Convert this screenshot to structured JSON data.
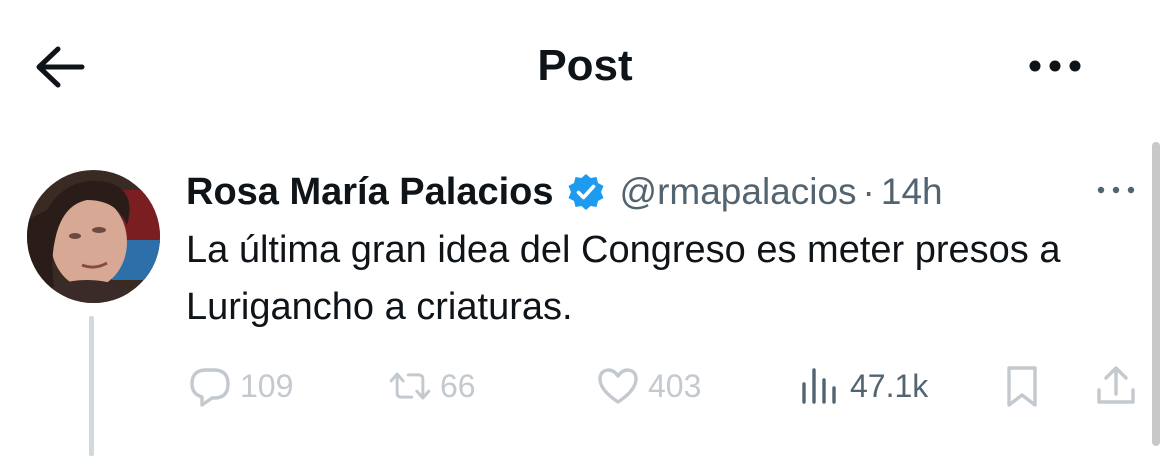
{
  "header": {
    "title": "Post",
    "back_icon": "arrow-left-icon",
    "more_icon": "ellipsis-icon"
  },
  "post": {
    "author_name": "Rosa María Palacios",
    "verified_color": "#1d9bf0",
    "handle": "@rmapalacios",
    "separator": "·",
    "time": "14h",
    "text": "La última gran idea del Congreso es meter presos a Lurigancho a criaturas."
  },
  "actions": {
    "replies": "109",
    "reposts": "66",
    "likes": "403",
    "views": "47.1k"
  },
  "colors": {
    "text": "#0f1419",
    "secondary": "#536471",
    "faded": "#c3c9ce",
    "accent": "#1d9bf0"
  }
}
